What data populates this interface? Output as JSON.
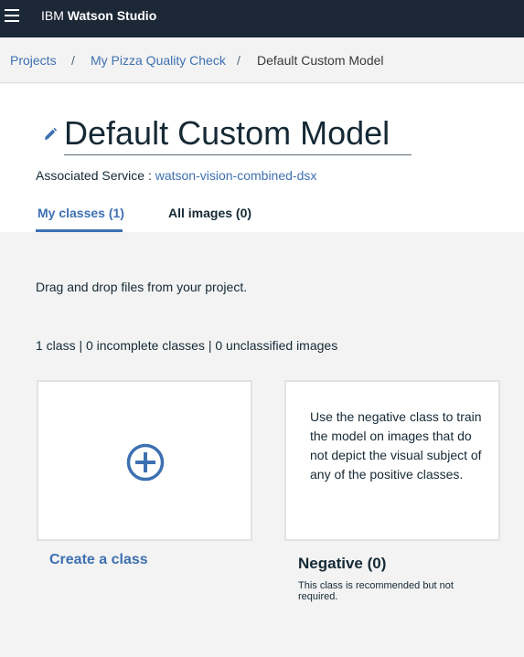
{
  "header": {
    "brand_prefix": "IBM",
    "brand_name": "Watson Studio",
    "menu_icon": "hamburger-menu-icon"
  },
  "breadcrumb": {
    "items": [
      "Projects",
      "My Pizza Quality Check",
      "Default Custom Model"
    ],
    "separator": "/"
  },
  "model": {
    "title": "Default Custom Model",
    "edit_icon": "pencil-edit-icon",
    "associated_label": "Associated Service :",
    "associated_service": "watson-vision-combined-dsx"
  },
  "tabs": [
    {
      "label": "My classes (1)",
      "active": true
    },
    {
      "label": "All images (0)",
      "active": false
    }
  ],
  "content": {
    "hint": "Drag and drop files from your project.",
    "counts": "1 class | 0 incomplete classes | 0 unclassified images"
  },
  "cards": {
    "create": {
      "label": "Create a class",
      "icon": "plus-circle-icon"
    },
    "negative": {
      "title": "Negative (0)",
      "description": "Use the negative class to train the model on images that do not depict the visual subject of any of the positive classes.",
      "note": "This class is recommended but not required."
    }
  },
  "colors": {
    "topbar": "#1d2837",
    "accent": "#3d70b2",
    "text": "#152935",
    "background": "#f3f3f3"
  }
}
